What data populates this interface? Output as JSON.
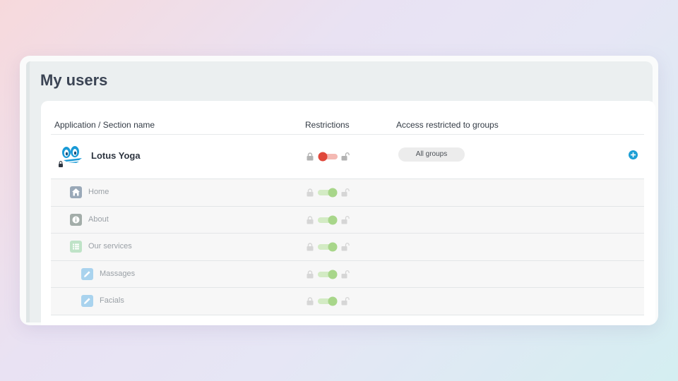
{
  "page": {
    "title": "My users"
  },
  "table": {
    "headers": {
      "name": "Application / Section name",
      "restrictions": "Restrictions",
      "groups": "Access restricted to groups"
    },
    "app": {
      "name": "Lotus Yoga",
      "restricted": true,
      "toggle_color": "#e0473a",
      "groups_label": "All groups",
      "add_icon": "plus-circle-icon"
    },
    "sections": [
      {
        "name": "Home",
        "icon": "home-icon",
        "icon_color": "#9aa9b8",
        "level": 1,
        "restricted": false
      },
      {
        "name": "About",
        "icon": "info-icon",
        "icon_color": "#a3ada9",
        "level": 1,
        "restricted": false
      },
      {
        "name": "Our services",
        "icon": "list-icon",
        "icon_color": "#bfe3c7",
        "level": 1,
        "restricted": false
      },
      {
        "name": "Massages",
        "icon": "pencil-icon",
        "icon_color": "#a9d3ee",
        "level": 2,
        "restricted": false
      },
      {
        "name": "Facials",
        "icon": "pencil-icon",
        "icon_color": "#a9d3ee",
        "level": 2,
        "restricted": false
      }
    ],
    "toggle_on_color": "#a8d68a"
  }
}
